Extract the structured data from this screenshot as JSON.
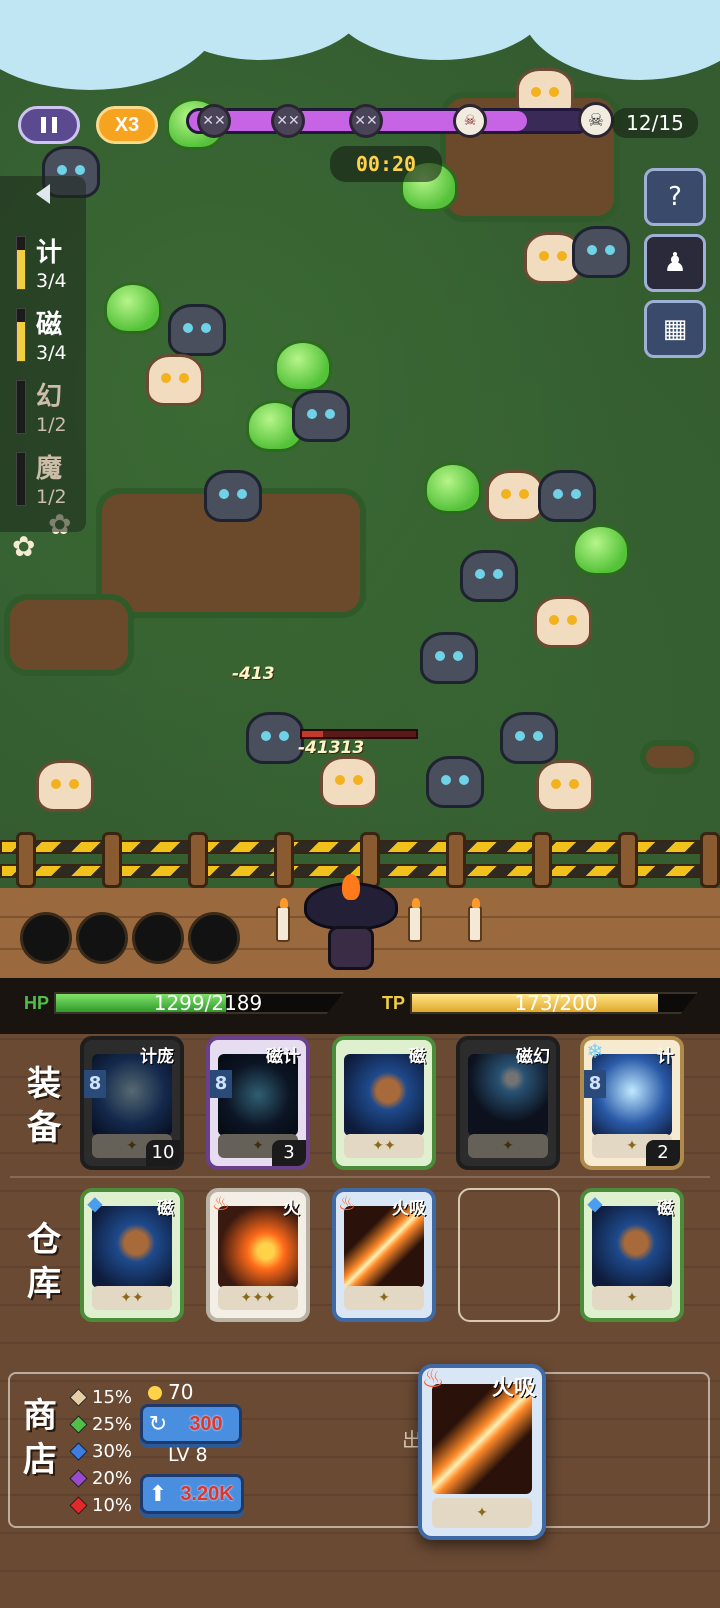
{
  "hud": {
    "speed_label": "X3",
    "wave_progress": 0.85,
    "wave_skulls": [
      "pale-skull",
      "pale-skull",
      "pale-skull",
      "boss-skull"
    ],
    "wave_count": "12/15",
    "timer": "00:20"
  },
  "side_buttons": [
    "help-card-icon",
    "character-portrait-icon",
    "ticket-machine-icon"
  ],
  "synergies": [
    {
      "name": "计",
      "count": "3/4",
      "level": 0.75
    },
    {
      "name": "磁",
      "count": "3/4",
      "level": 0.75
    },
    {
      "name": "幻",
      "count": "1/2",
      "level": 0
    },
    {
      "name": "魔",
      "count": "1/2",
      "level": 0
    }
  ],
  "battle": {
    "damage_numbers": [
      "-413",
      "-41313"
    ],
    "enemy_hp_level": 0.18
  },
  "stats": {
    "hp_label": "HP",
    "hp_value": "1299/2189",
    "hp_level": 0.593,
    "tp_label": "TP",
    "tp_value": "173/200",
    "tp_level": 0.865
  },
  "equip": {
    "title": "装\n备",
    "cards": [
      {
        "tag": "计庞",
        "level": "8",
        "stars": "✦",
        "count": "10",
        "style": "c-dark dim",
        "art": "art-ice"
      },
      {
        "tag": "磁计",
        "level": "8",
        "stars": "✦",
        "count": "3",
        "style": "c-purple dim",
        "art": "art-orb"
      },
      {
        "tag": "磁",
        "level": "",
        "stars": "✦✦",
        "count": "",
        "style": "c-green",
        "art": "art-bullet"
      },
      {
        "tag": "磁幻",
        "level": "",
        "stars": "✦",
        "count": "",
        "style": "c-dark dim",
        "art": "art-spark"
      },
      {
        "tag": "计",
        "level": "8",
        "stars": "✦",
        "count": "2",
        "style": "c-gold",
        "art": "art-ice"
      }
    ]
  },
  "storage": {
    "title": "仓\n库",
    "cards": [
      {
        "tag": "磁",
        "stars": "✦✦",
        "style": "c-green",
        "art": "art-bullet"
      },
      {
        "tag": "火",
        "stars": "✦✦✦",
        "style": "c-white",
        "art": "art-fire"
      },
      {
        "tag": "火吸",
        "stars": "✦",
        "style": "c-blue",
        "art": "art-beam"
      },
      null,
      {
        "tag": "磁",
        "stars": "✦",
        "style": "c-green",
        "art": "art-bullet"
      }
    ]
  },
  "shop": {
    "title": "商\n店",
    "odds": [
      {
        "pct": "15%",
        "color": "#e6cfa8"
      },
      {
        "pct": "25%",
        "color": "#4fbf4a"
      },
      {
        "pct": "30%",
        "color": "#3f7ee0"
      },
      {
        "pct": "20%",
        "color": "#9a4ad0"
      },
      {
        "pct": "10%",
        "color": "#e02a2a"
      }
    ],
    "coins": "70",
    "refresh_cost": "300",
    "level_label": "LV 8",
    "upgrade_cost": "3.20K",
    "sell_label": "出售"
  },
  "drag_card": {
    "tag": "火吸",
    "stars": "✦"
  }
}
